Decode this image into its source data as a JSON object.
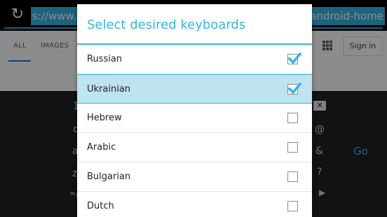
{
  "browser": {
    "url_left": "s://www.c",
    "url_right": "=android-home",
    "reload_icon": "reload-icon",
    "tabs": [
      {
        "label": "ALL"
      },
      {
        "label": "IMAGES"
      }
    ],
    "signin_label": "Sign in",
    "apps_icon": "apps-grid-icon"
  },
  "keyboard": {
    "key_one": "1",
    "key_q": "q",
    "key_a": "a",
    "key_z": "z",
    "key_sym": "=/",
    "key_at": "@",
    "key_amp": "&",
    "key_go": "Go",
    "key_question": "?",
    "key_arrow": "▶",
    "backspace_icon": "backspace-icon"
  },
  "dialog": {
    "title": "Select desired keyboards",
    "items": [
      {
        "label": "Russian",
        "checked": true,
        "selected": false
      },
      {
        "label": "Ukrainian",
        "checked": true,
        "selected": true
      },
      {
        "label": "Hebrew",
        "checked": false,
        "selected": false
      },
      {
        "label": "Arabic",
        "checked": false,
        "selected": false
      },
      {
        "label": "Bulgarian",
        "checked": false,
        "selected": false
      },
      {
        "label": "Dutch",
        "checked": false,
        "selected": false
      }
    ]
  },
  "colors": {
    "accent": "#33b5e5",
    "selected_row": "#bee3f1",
    "google_blue": "#1a73e8"
  }
}
